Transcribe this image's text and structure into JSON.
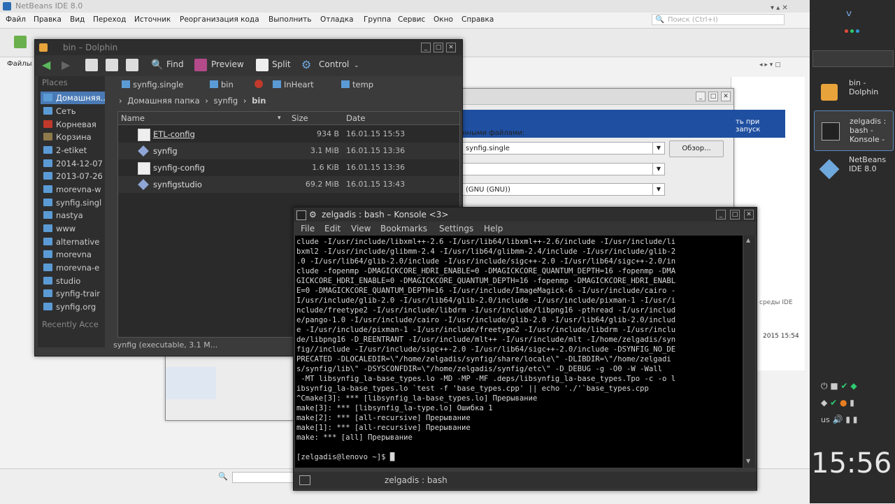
{
  "netbeans": {
    "title": "NetBeans IDE 8.0",
    "menu": [
      "Файл",
      "Правка",
      "Вид",
      "Переход",
      "Источник",
      "Реорганизация кода",
      "Выполнить",
      "Отладка",
      "Группа",
      "Сервис",
      "Окно",
      "Справка"
    ],
    "search_placeholder": "Поиск (Ctrl+I)",
    "files_label": "Файлы",
    "bottom_time": "2015 15:54",
    "ide_link": "среды IDE"
  },
  "dialog": {
    "label_files": "нными файлами:",
    "combo1": "synfig.single",
    "browse": "Обзор...",
    "combo3": "(GNU (GNU))",
    "blue_text": "ть при запуск"
  },
  "panel": {
    "tasks": [
      {
        "line1": "bin -",
        "line2": "Dolphin",
        "line3": ""
      },
      {
        "line1": "zelgadis :",
        "line2": "bash -",
        "line3": "Konsole -"
      },
      {
        "line1": "NetBeans",
        "line2": "IDE 8.0",
        "line3": ""
      }
    ],
    "lang": "us",
    "clock": "15:56"
  },
  "dolphin": {
    "title": "bin – Dolphin",
    "toolbar": {
      "find": "Find",
      "preview": "Preview",
      "split": "Split",
      "control": "Control"
    },
    "places_header": "Places",
    "places": [
      "Домашняя...",
      "Сеть",
      "Корневая",
      "Корзина",
      "2-etiket",
      "2014-12-07",
      "2013-07-26",
      "morevna-w",
      "synfig.singl",
      "nastya",
      "www",
      "alternative",
      "morevna",
      "morevna-e",
      "studio",
      "synfig-trair",
      "synfig.org"
    ],
    "recent": "Recently Acce",
    "tabs": [
      "synfig.single",
      "bin",
      "InHeart",
      "temp"
    ],
    "crumb": [
      "Домашняя папка",
      "synfig",
      "bin"
    ],
    "columns": {
      "name": "Name",
      "size": "Size",
      "date": "Date"
    },
    "files": [
      {
        "name": "ETL-config",
        "size": "934 B",
        "date": "16.01.15 15:53"
      },
      {
        "name": "synfig",
        "size": "3.1 MiB",
        "date": "16.01.15 13:36"
      },
      {
        "name": "synfig-config",
        "size": "1.6 KiB",
        "date": "16.01.15 13:36"
      },
      {
        "name": "synfigstudio",
        "size": "69.2 MiB",
        "date": "16.01.15 13:43"
      }
    ],
    "status": "synfig (executable, 3.1 M..."
  },
  "konsole": {
    "title": "zelgadis : bash – Konsole <3>",
    "menu": [
      "File",
      "Edit",
      "View",
      "Bookmarks",
      "Settings",
      "Help"
    ],
    "lines": [
      "clude -I/usr/include/libxml++-2.6 -I/usr/lib64/libxml++-2.6/include -I/usr/include/li",
      "bxml2 -I/usr/include/glibmm-2.4 -I/usr/lib64/glibmm-2.4/include -I/usr/include/glib-2",
      ".0 -I/usr/lib64/glib-2.0/include -I/usr/include/sigc++-2.0 -I/usr/lib64/sigc++-2.0/in",
      "clude -fopenmp -DMAGICKCORE_HDRI_ENABLE=0 -DMAGICKCORE_QUANTUM_DEPTH=16 -fopenmp -DMA",
      "GICKCORE_HDRI_ENABLE=0 -DMAGICKCORE_QUANTUM_DEPTH=16 -fopenmp -DMAGICKCORE_HDRI_ENABL",
      "E=0 -DMAGICKCORE_QUANTUM_DEPTH=16 -I/usr/include/ImageMagick-6 -I/usr/include/cairo -",
      "I/usr/include/glib-2.0 -I/usr/lib64/glib-2.0/include -I/usr/include/pixman-1 -I/usr/i",
      "nclude/freetype2 -I/usr/include/libdrm -I/usr/include/libpng16 -pthread -I/usr/includ",
      "e/pango-1.0 -I/usr/include/cairo -I/usr/include/glib-2.0 -I/usr/lib64/glib-2.0/includ",
      "e -I/usr/include/pixman-1 -I/usr/include/freetype2 -I/usr/include/libdrm -I/usr/inclu",
      "de/libpng16 -D_REENTRANT -I/usr/include/mlt++ -I/usr/include/mlt -I/home/zelgadis/syn",
      "fig//include -I/usr/include/sigc++-2.0 -I/usr/lib64/sigc++-2.0/include -DSYNFIG_NO_DE",
      "PRECATED -DLOCALEDIR=\\\"/home/zelgadis/synfig/share/locale\\\" -DLIBDIR=\\\"/home/zelgadi",
      "s/synfig/lib\\\" -DSYSCONFDIR=\\\"/home/zelgadis/synfig/etc\\\" -D_DEBUG -g -O0 -W -Wall",
      " -MT libsynfig_la-base_types.lo -MD -MP -MF .deps/libsynfig_la-base_types.Tpo -c -o l",
      "ibsynfig_la-base_types.lo `test -f 'base_types.cpp' || echo './'`base_types.cpp",
      "^Cmake[3]: *** [libsynfig_la-base_types.lo] Прерывание",
      "make[3]: *** [libsynfig_la-type.lo] Ошибка 1",
      "make[2]: *** [all-recursive] Прерывание",
      "make[1]: *** [all-recursive] Прерывание",
      "make: *** [all] Прерывание",
      "",
      "[zelgadis@lenovo ~]$ █"
    ],
    "tab_label": "zelgadis : bash"
  }
}
